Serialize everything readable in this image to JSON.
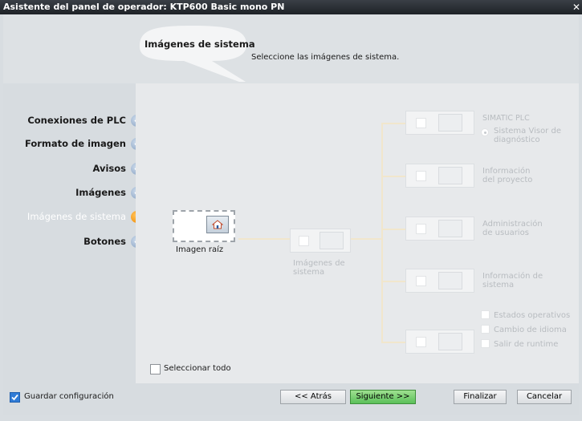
{
  "window": {
    "title": "Asistente del panel de operador: KTP600 Basic mono PN"
  },
  "header": {
    "title": "Imágenes de sistema",
    "subtitle": "Seleccione las imágenes de sistema."
  },
  "steps": [
    {
      "label": "Conexiones de PLC",
      "state": "done"
    },
    {
      "label": "Formato de imagen",
      "state": "done"
    },
    {
      "label": "Avisos",
      "state": "done"
    },
    {
      "label": "Imágenes",
      "state": "done"
    },
    {
      "label": "Imágenes de sistema",
      "state": "active"
    },
    {
      "label": "Botones",
      "state": "done"
    }
  ],
  "tree": {
    "root_label": "Imagen raíz",
    "system_label": "Imágenes de sistema",
    "branches": [
      {
        "label": "SIMATIC PLC",
        "option": "Sistema Visor de diagnóstico"
      },
      {
        "label": "Información del proyecto"
      },
      {
        "label": "Administración de usuarios"
      },
      {
        "label": "Información de sistema"
      },
      {
        "options": [
          "Estados operativos",
          "Cambio de idioma",
          "Salir de runtime"
        ]
      }
    ]
  },
  "select_all": {
    "label": "Seleccionar todo",
    "checked": false
  },
  "footer": {
    "save_config_label": "Guardar configuración",
    "save_config_checked": true,
    "back_label": "<< Atrás",
    "next_label": "Siguiente >>",
    "finish_label": "Finalizar",
    "cancel_label": "Cancelar"
  },
  "colors": {
    "accent": "#f08a00",
    "check": "#8aa3c2",
    "next_button": "#5bc05a"
  }
}
